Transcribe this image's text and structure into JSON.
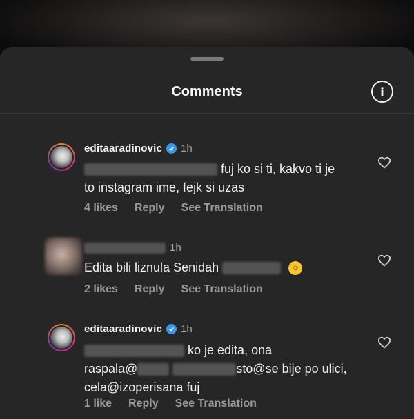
{
  "sheet": {
    "title": "Comments"
  },
  "comments": [
    {
      "username": "editaaradinovic",
      "verified": true,
      "time": "1h",
      "text_part1": "fuj ko si ti, kakvo ti je",
      "text_part2": "to instagram ime, fejk si uzas",
      "likes": "4 likes",
      "reply": "Reply",
      "translate": "See Translation"
    },
    {
      "username": "",
      "verified": false,
      "time": "1h",
      "text_part1": "Edita bili liznula Senidah",
      "emoji": "face-with-tears-of-joy",
      "likes": "2 likes",
      "reply": "Reply",
      "translate": "See Translation"
    },
    {
      "username": "editaaradinovic",
      "verified": true,
      "time": "1h",
      "text_part1": "ko je edita, ona",
      "text_part2a": "raspala@",
      "text_part2b": "sto@se bije po ulici,",
      "text_part3": "cela@izoperisana fuj",
      "likes": "1 like",
      "reply": "Reply",
      "translate": "See Translation"
    }
  ],
  "colors": {
    "sheet_bg": "#262626",
    "verified_blue": "#3897f0",
    "secondary_text": "#9a9a9a"
  }
}
